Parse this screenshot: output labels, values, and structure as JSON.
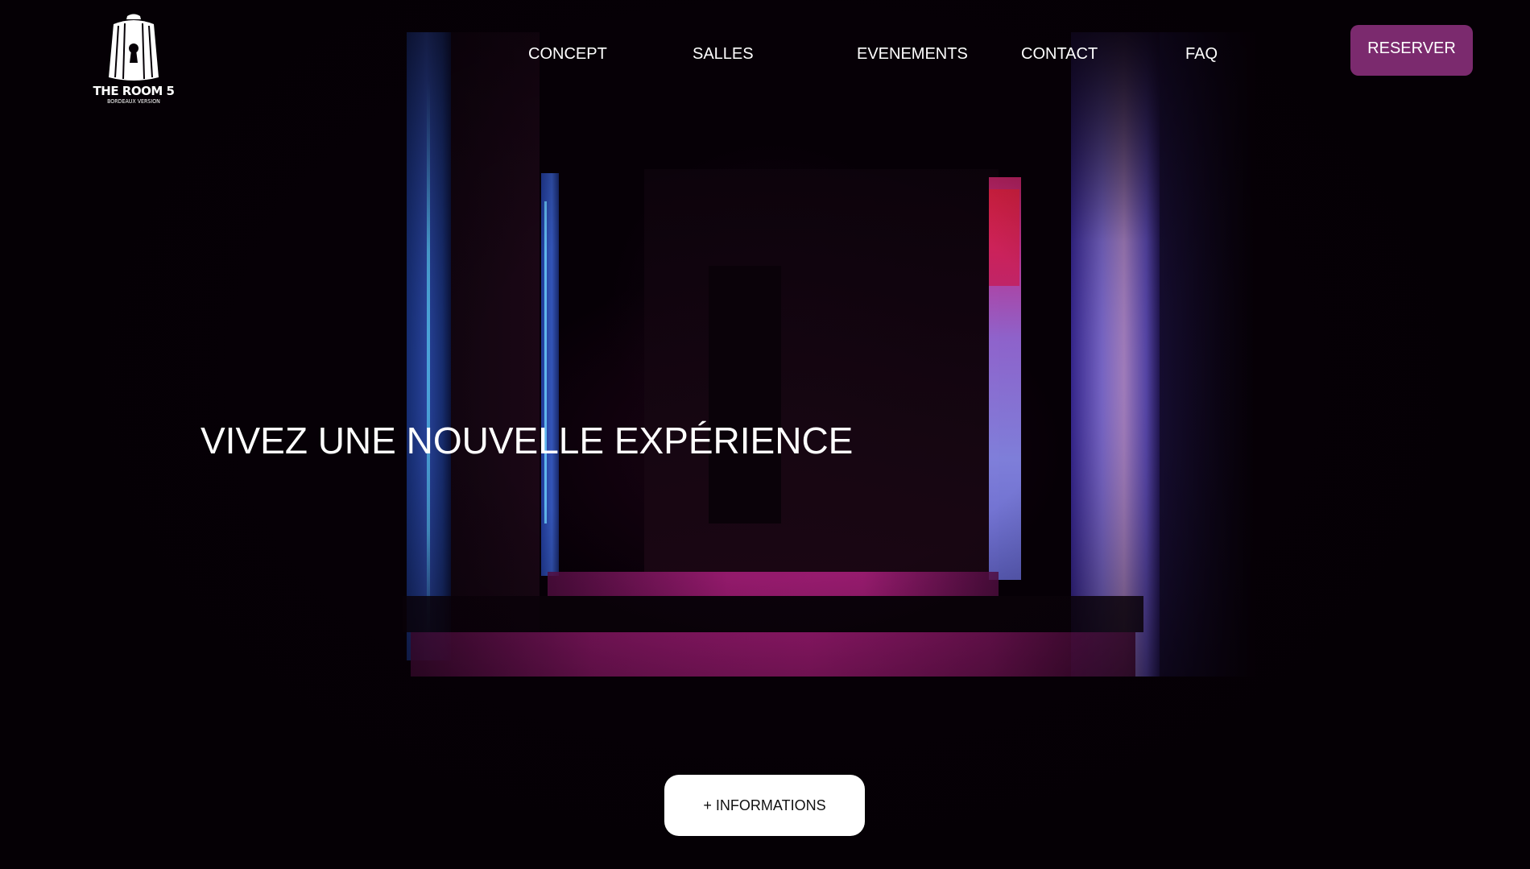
{
  "logo": {
    "title": "THE ROOM 5",
    "subtitle": "BORDEAUX VERSION"
  },
  "nav": {
    "items": [
      {
        "label": "CONCEPT"
      },
      {
        "label": "SALLES"
      },
      {
        "label": "EVENEMENTS"
      },
      {
        "label": "CONTACT"
      },
      {
        "label": "FAQ"
      }
    ],
    "reserve_label": "RESERVER"
  },
  "hero": {
    "headline": "VIVEZ UNE NOUVELLE EXPÉRIENCE",
    "info_button_label": "+ INFORMATIONS"
  },
  "colors": {
    "accent": "#7b2a6e",
    "background": "#060006",
    "text": "#ffffff",
    "info_button_bg": "#ffffff"
  },
  "icons": {
    "logo_mark": "canele-keyhole-icon"
  }
}
